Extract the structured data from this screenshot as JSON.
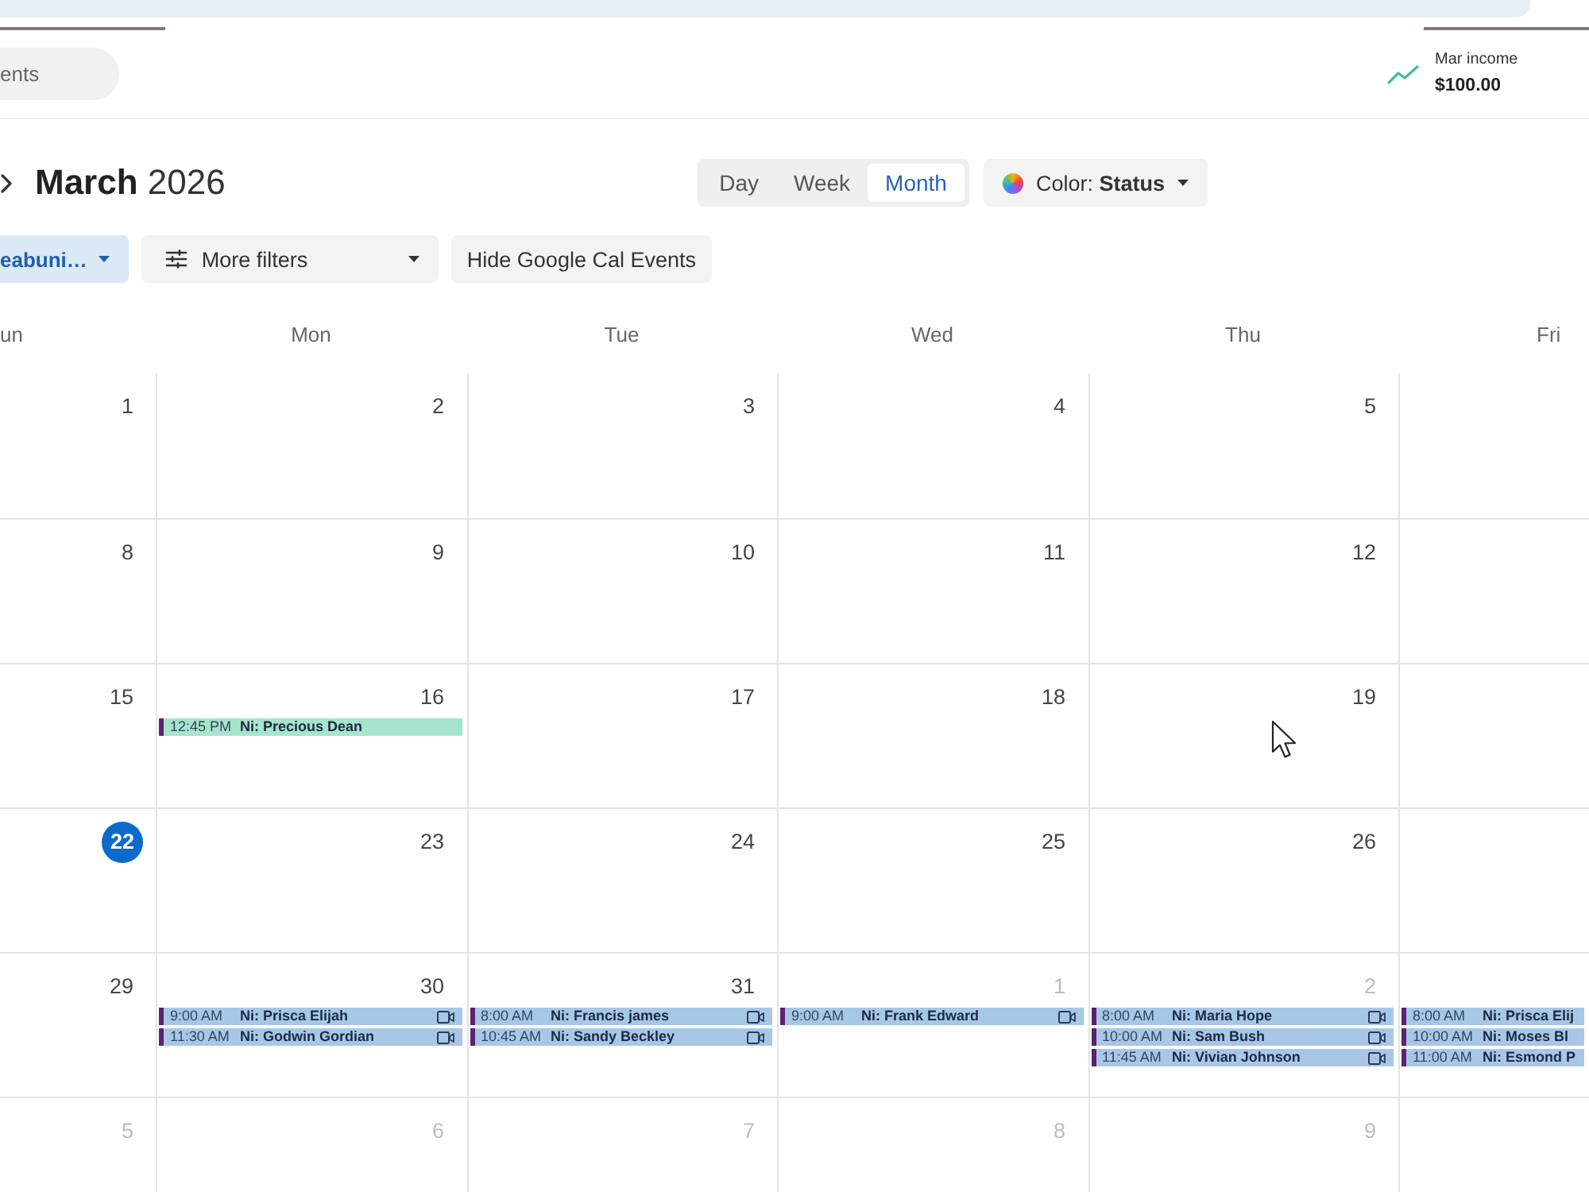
{
  "header": {
    "search": {
      "placeholder": "ents"
    },
    "income": {
      "label": "Mar income",
      "amount": "$100.00"
    }
  },
  "toolbar": {
    "title": "**March** 2026",
    "views": [
      {
        "label": "Day",
        "selected": false
      },
      {
        "label": "Week",
        "selected": false
      },
      {
        "label": "Month",
        "selected": true
      }
    ],
    "color_menu": {
      "label": "Color: **Status**"
    }
  },
  "filters": [
    {
      "kind": "chip",
      "label": "eabuni…"
    },
    {
      "kind": "menu",
      "label": "More filters"
    },
    {
      "kind": "button",
      "label": "Hide Google Cal Events"
    }
  ],
  "calendar": {
    "weekdays": [
      "un",
      "Mon",
      "Tue",
      "Wed",
      "Thu",
      "Fri"
    ],
    "weeks": [
      {
        "days": [
          {
            "date": "1",
            "muted": false,
            "today": false
          },
          {
            "date": "2",
            "muted": false,
            "today": false
          },
          {
            "date": "3",
            "muted": false,
            "today": false
          },
          {
            "date": "4",
            "muted": false,
            "today": false
          },
          {
            "date": "5",
            "muted": false,
            "today": false
          }
        ]
      },
      {
        "days": [
          {
            "date": "8",
            "muted": false,
            "today": false
          },
          {
            "date": "9",
            "muted": false,
            "today": false
          },
          {
            "date": "10",
            "muted": false,
            "today": false
          },
          {
            "date": "11",
            "muted": false,
            "today": false
          },
          {
            "date": "12",
            "muted": false,
            "today": false
          }
        ]
      },
      {
        "days": [
          {
            "date": "15",
            "muted": false,
            "today": false
          },
          {
            "date": "16",
            "muted": false,
            "today": false,
            "events": [
              {
                "time": "12:45 PM",
                "title": "Ni: Precious Dean",
                "color": "#a6e4cb",
                "video": false
              }
            ]
          },
          {
            "date": "17",
            "muted": false,
            "today": false
          },
          {
            "date": "18",
            "muted": false,
            "today": false
          },
          {
            "date": "19",
            "muted": false,
            "today": false
          }
        ]
      },
      {
        "days": [
          {
            "date": "22",
            "muted": false,
            "today": true
          },
          {
            "date": "23",
            "muted": false,
            "today": false
          },
          {
            "date": "24",
            "muted": false,
            "today": false
          },
          {
            "date": "25",
            "muted": false,
            "today": false
          },
          {
            "date": "26",
            "muted": false,
            "today": false
          }
        ]
      },
      {
        "days": [
          {
            "date": "29",
            "muted": false,
            "today": false
          },
          {
            "date": "30",
            "muted": false,
            "today": false,
            "events": [
              {
                "time": "9:00 AM",
                "title": "Ni: Prisca Elijah",
                "color": "#a8c7e7",
                "video": true
              },
              {
                "time": "11:30 AM",
                "title": "Ni: Godwin Gordian",
                "color": "#a8c7e7",
                "video": true
              }
            ]
          },
          {
            "date": "31",
            "muted": false,
            "today": false,
            "events": [
              {
                "time": "8:00 AM",
                "title": "Ni: Francis james",
                "color": "#a8c7e7",
                "video": true
              },
              {
                "time": "10:45 AM",
                "title": "Ni: Sandy Beckley",
                "color": "#a8c7e7",
                "video": true
              }
            ]
          },
          {
            "date": "1",
            "muted": true,
            "today": false,
            "events": [
              {
                "time": "9:00 AM",
                "title": "Ni: Frank Edward",
                "color": "#a8c7e7",
                "video": true
              }
            ]
          },
          {
            "date": "2",
            "muted": true,
            "today": false,
            "events": [
              {
                "time": "8:00 AM",
                "title": "Ni: Maria Hope",
                "color": "#a8c7e7",
                "video": true
              },
              {
                "time": "10:00 AM",
                "title": "Ni: Sam Bush",
                "color": "#a8c7e7",
                "video": true
              },
              {
                "time": "11:45 AM",
                "title": "Ni: Vivian Johnson",
                "color": "#a8c7e7",
                "video": true
              }
            ]
          },
          {
            "events": [
              {
                "time": "8:00 AM",
                "title": "Ni: Prisca Elij",
                "color": "#a8c7e7",
                "video": false
              },
              {
                "time": "10:00 AM",
                "title": "Ni: Moses Bl",
                "color": "#a8c7e7",
                "video": false
              },
              {
                "time": "11:00 AM",
                "title": "Ni: Esmond P",
                "color": "#a8c7e7",
                "video": false
              }
            ]
          }
        ]
      },
      {
        "days": [
          {
            "date": "5",
            "muted": true,
            "today": false
          },
          {
            "date": "6",
            "muted": true,
            "today": false
          },
          {
            "date": "7",
            "muted": true,
            "today": false
          },
          {
            "date": "8",
            "muted": true,
            "today": false
          },
          {
            "date": "9",
            "muted": true,
            "today": false
          }
        ]
      }
    ]
  }
}
